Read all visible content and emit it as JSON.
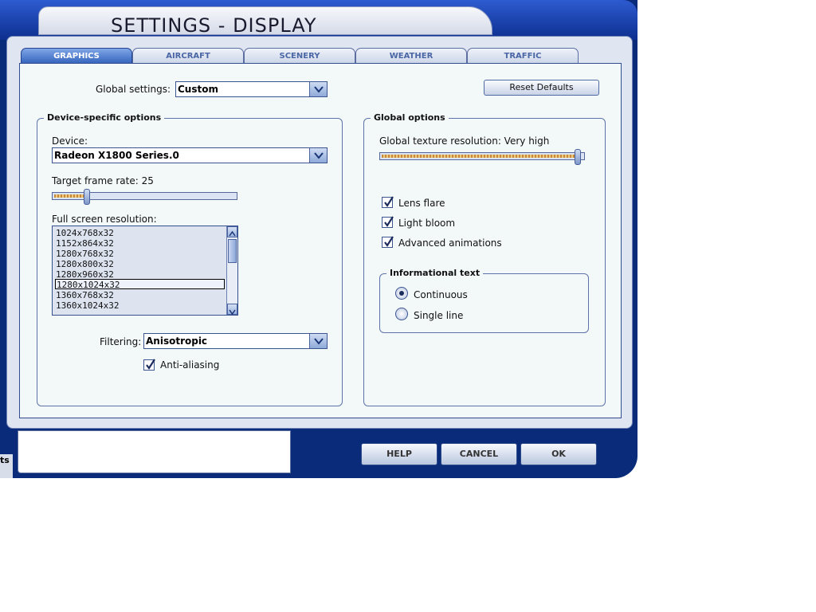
{
  "window": {
    "title": "SETTINGS - DISPLAY"
  },
  "tabs": [
    "GRAPHICS",
    "AIRCRAFT",
    "SCENERY",
    "WEATHER",
    "TRAFFIC"
  ],
  "global_settings": {
    "label": "Global settings:",
    "value": "Custom"
  },
  "reset_defaults": "Reset Defaults",
  "device_group": {
    "title": "Device-specific options",
    "device_label": "Device:",
    "device_value": "Radeon X1800 Series.0",
    "frame_rate_label": "Target frame rate: 25",
    "frame_rate_level": 0.18,
    "resolution_label": "Full screen resolution:",
    "resolutions": [
      "1024x768x32",
      "1152x864x32",
      "1280x768x32",
      "1280x800x32",
      "1280x960x32",
      "1280x1024x32",
      "1360x768x32",
      "1360x1024x32"
    ],
    "selected_resolution": "1280x1024x32",
    "filtering_label": "Filtering:",
    "filtering_value": "Anisotropic",
    "anti_aliasing": {
      "label": "Anti-aliasing",
      "checked": true
    }
  },
  "global_group": {
    "title": "Global options",
    "texture_label": "Global texture resolution: Very high",
    "texture_level": 1.0,
    "checkboxes": [
      {
        "label": "Lens flare",
        "checked": true
      },
      {
        "label": "Light bloom",
        "checked": true
      },
      {
        "label": "Advanced animations",
        "checked": true
      }
    ],
    "info_text": {
      "title": "Informational text",
      "options": [
        {
          "label": "Continuous",
          "selected": true
        },
        {
          "label": "Single line",
          "selected": false
        }
      ]
    }
  },
  "buttons": {
    "help": "HELP",
    "cancel": "CANCEL",
    "ok": "OK"
  },
  "stub_text": "ts",
  "colors": {
    "frame": "#0a2a7a",
    "accent": "#2f5fba",
    "panel": "#f3f8f8"
  }
}
